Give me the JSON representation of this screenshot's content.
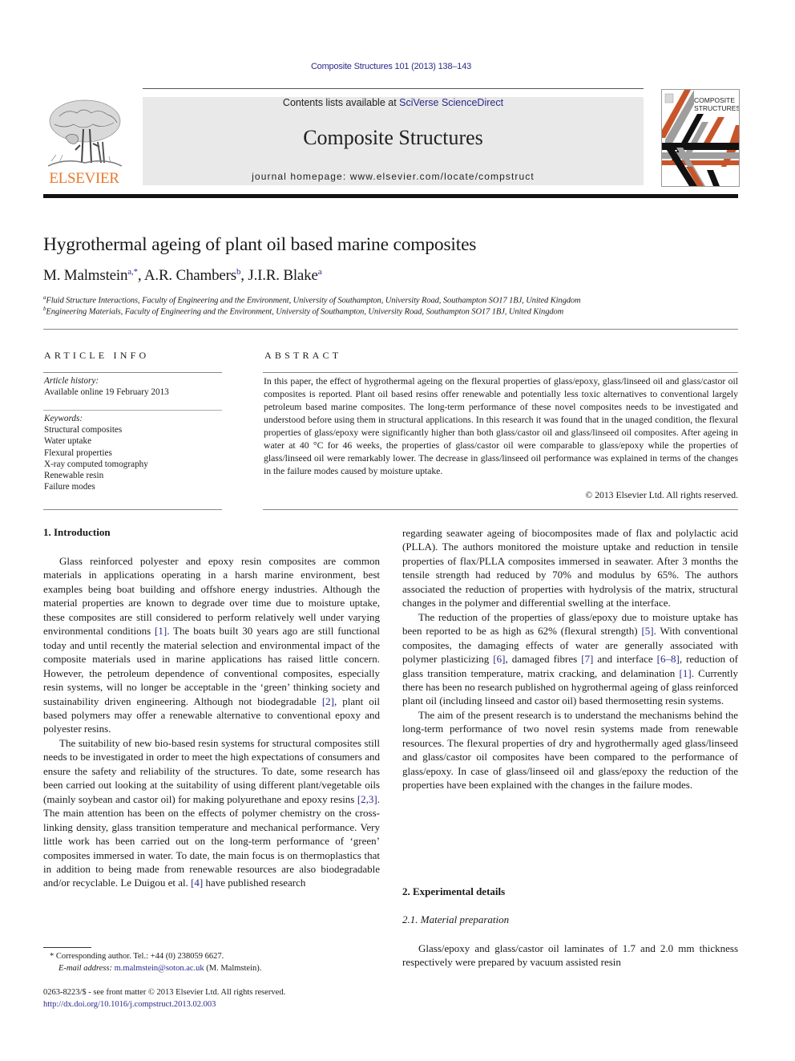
{
  "header": {
    "journal_ref": "Composite Structures 101 (2013) 138–143",
    "contents_prefix": "Contents lists available at ",
    "contents_link": "SciVerse ScienceDirect",
    "journal_name": "Composite Structures",
    "homepage": "journal homepage: www.elsevier.com/locate/compstruct",
    "publisher_logo_text": "ELSEVIER",
    "cover_title_line1": "COMPOSITE",
    "cover_title_line2": "STRUCTURES",
    "colors": {
      "publisher_orange": "#e8792c",
      "link_blue": "#2a2a8a",
      "masthead_gray": "#e9e9e9"
    }
  },
  "article": {
    "title": "Hygrothermal ageing of plant oil based marine composites",
    "authors": [
      {
        "name": "M. Malmstein",
        "sup": "a,*",
        "sep": ", "
      },
      {
        "name": "A.R. Chambers",
        "sup": "b",
        "sep": ", "
      },
      {
        "name": "J.I.R. Blake",
        "sup": "a",
        "sep": ""
      }
    ],
    "affiliations": [
      {
        "mark": "a",
        "text": "Fluid Structure Interactions, Faculty of Engineering and the Environment, University of Southampton, University Road, Southampton SO17 1BJ, United Kingdom"
      },
      {
        "mark": "b",
        "text": "Engineering Materials, Faculty of Engineering and the Environment, University of Southampton, University Road, Southampton SO17 1BJ, United Kingdom"
      }
    ]
  },
  "article_info": {
    "heading": "ARTICLE INFO",
    "history_label": "Article history:",
    "history_value": "Available online 19 February 2013",
    "keywords_label": "Keywords:",
    "keywords": [
      "Structural composites",
      "Water uptake",
      "Flexural properties",
      "X-ray computed tomography",
      "Renewable resin",
      "Failure modes"
    ]
  },
  "abstract": {
    "heading": "ABSTRACT",
    "text": "In this paper, the effect of hygrothermal ageing on the flexural properties of glass/epoxy, glass/linseed oil and glass/castor oil composites is reported. Plant oil based resins offer renewable and potentially less toxic alternatives to conventional largely petroleum based marine composites. The long-term performance of these novel composites needs to be investigated and understood before using them in structural applications. In this research it was found that in the unaged condition, the flexural properties of glass/epoxy were significantly higher than both glass/castor oil and glass/linseed oil composites. After ageing in water at 40 °C for 46 weeks, the properties of glass/castor oil were comparable to glass/epoxy while the properties of glass/linseed oil were remarkably lower. The decrease in glass/linseed oil performance was explained in terms of the changes in the failure modes caused by moisture uptake.",
    "copyright": "© 2013 Elsevier Ltd. All rights reserved."
  },
  "sections": {
    "intro_heading": "1. Introduction",
    "intro_left": [
      [
        {
          "t": "Glass reinforced polyester and epoxy resin composites are common materials in applications operating in a harsh marine environment, best examples being boat building and offshore energy industries. Although the material properties are known to degrade over time due to moisture uptake, these composites are still considered to perform relatively well under varying environmental conditions "
        },
        {
          "t": "[1]",
          "ref": true
        },
        {
          "t": ". The boats built 30 years ago are still functional today and until recently the material selection and environmental impact of the composite materials used in marine applications has raised little concern. However, the petroleum dependence of conventional composites, especially resin systems, will no longer be acceptable in the ‘green’ thinking society and sustainability driven engineering. Although not biodegradable "
        },
        {
          "t": "[2]",
          "ref": true
        },
        {
          "t": ", plant oil based polymers may offer a renewable alternative to conventional epoxy and polyester resins."
        }
      ],
      [
        {
          "t": "The suitability of new bio-based resin systems for structural composites still needs to be investigated in order to meet the high expectations of consumers and ensure the safety and reliability of the structures. To date, some research has been carried out looking at the suitability of using different plant/vegetable oils (mainly soybean and castor oil) for making polyurethane and epoxy resins "
        },
        {
          "t": "[2,3]",
          "ref": true
        },
        {
          "t": ". The main attention has been on the effects of polymer chemistry on the cross-linking density, glass transition temperature and mechanical performance. Very little work has been carried out on the long-term performance of ‘green’ composites immersed in water. To date, the main focus is on thermoplastics that in addition to being made from renewable resources are also biodegradable and/or recyclable. Le Duigou et al. "
        },
        {
          "t": "[4]",
          "ref": true
        },
        {
          "t": " have published research"
        }
      ]
    ],
    "intro_right": [
      [
        {
          "t": "regarding seawater ageing of biocomposites made of flax and polylactic acid (PLLA). The authors monitored the moisture uptake and reduction in tensile properties of flax/PLLA composites immersed in seawater. After 3 months the tensile strength had reduced by 70% and modulus by 65%. The authors associated the reduction of properties with hydrolysis of the matrix, structural changes in the polymer and differential swelling at the interface."
        }
      ],
      [
        {
          "t": "The reduction of the properties of glass/epoxy due to moisture uptake has been reported to be as high as 62% (flexural strength) "
        },
        {
          "t": "[5]",
          "ref": true
        },
        {
          "t": ". With conventional composites, the damaging effects of water are generally associated with polymer plasticizing "
        },
        {
          "t": "[6]",
          "ref": true
        },
        {
          "t": ", damaged fibres "
        },
        {
          "t": "[7]",
          "ref": true
        },
        {
          "t": " and interface "
        },
        {
          "t": "[6–8]",
          "ref": true
        },
        {
          "t": ", reduction of glass transition temperature, matrix cracking, and delamination "
        },
        {
          "t": "[1]",
          "ref": true
        },
        {
          "t": ". Currently there has been no research published on hygrothermal ageing of glass reinforced plant oil (including linseed and castor oil) based thermosetting resin systems."
        }
      ],
      [
        {
          "t": "The aim of the present research is to understand the mechanisms behind the long-term performance of two novel resin systems made from renewable resources. The flexural properties of dry and hygrothermally aged glass/linseed and glass/castor oil composites have been compared to the performance of glass/epoxy. In case of glass/linseed oil and glass/epoxy the reduction of the properties have been explained with the changes in the failure modes."
        }
      ]
    ],
    "exp_heading": "2. Experimental details",
    "sub_heading": "2.1. Material preparation",
    "exp_text": "Glass/epoxy and glass/castor oil laminates of 1.7 and 2.0 mm thickness respectively were prepared by vacuum assisted resin"
  },
  "footer": {
    "corresponding_mark": "*",
    "corresponding": "Corresponding author. Tel.: +44 (0) 238059 6627.",
    "email_label": "E-mail address:",
    "email": "m.malmstein@soton.ac.uk",
    "email_suffix": " (M. Malmstein).",
    "front_matter": "0263-8223/$ - see front matter © 2013 Elsevier Ltd. All rights reserved.",
    "doi": "http://dx.doi.org/10.1016/j.compstruct.2013.02.003"
  }
}
